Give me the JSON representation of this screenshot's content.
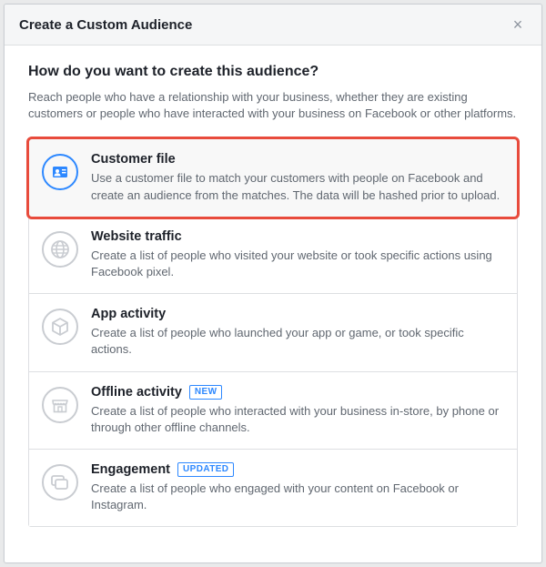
{
  "modal": {
    "title": "Create a Custom Audience",
    "close_label": "×"
  },
  "body": {
    "question": "How do you want to create this audience?",
    "intro": "Reach people who have a relationship with your business, whether they are existing customers or people who have interacted with your business on Facebook or other platforms."
  },
  "badges": {
    "new": "NEW",
    "updated": "UPDATED"
  },
  "options": {
    "customer_file": {
      "title": "Customer file",
      "desc": "Use a customer file to match your customers with people on Facebook and create an audience from the matches. The data will be hashed prior to upload."
    },
    "website_traffic": {
      "title": "Website traffic",
      "desc": "Create a list of people who visited your website or took specific actions using Facebook pixel."
    },
    "app_activity": {
      "title": "App activity",
      "desc": "Create a list of people who launched your app or game, or took specific actions."
    },
    "offline_activity": {
      "title": "Offline activity",
      "desc": "Create a list of people who interacted with your business in-store, by phone or through other offline channels."
    },
    "engagement": {
      "title": "Engagement",
      "desc": "Create a list of people who engaged with your content on Facebook or Instagram."
    }
  }
}
